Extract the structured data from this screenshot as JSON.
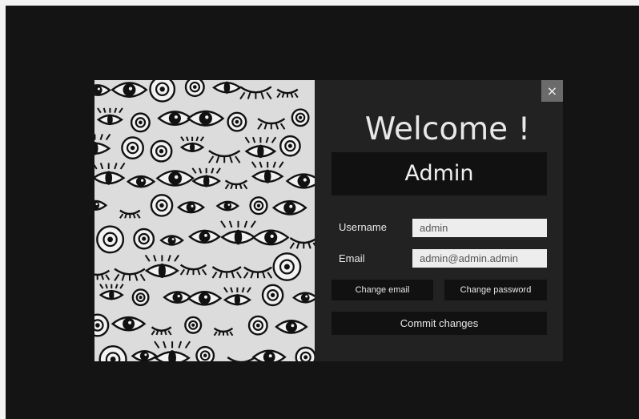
{
  "modal": {
    "close_glyph": "×",
    "welcome": "Welcome !",
    "user_display_name": "Admin",
    "form": {
      "username_label": "Username",
      "username_value": "admin",
      "email_label": "Email",
      "email_value": "admin@admin.admin"
    },
    "buttons": {
      "change_email": "Change email",
      "change_password": "Change password",
      "commit": "Commit changes"
    },
    "illustration": "eyes-pattern"
  },
  "colors": {
    "backdrop": "#141414",
    "modal": "#222222",
    "dark_box": "#111111",
    "input_bg": "#ededed",
    "pattern_bg": "#dcdcdc"
  }
}
